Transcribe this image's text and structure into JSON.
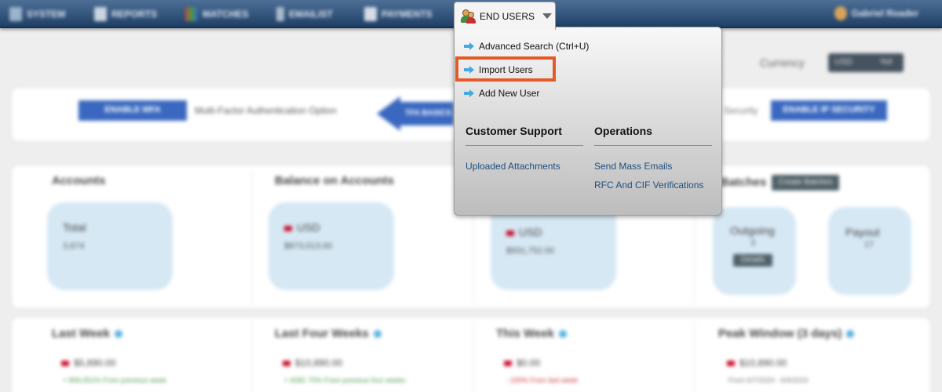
{
  "nav": {
    "items": [
      {
        "label": "SYSTEM",
        "icon": "system-icon"
      },
      {
        "label": "REPORTS",
        "icon": "reports-icon"
      },
      {
        "label": "MATCHES",
        "icon": "matches-icon"
      },
      {
        "label": "EMAILIST",
        "icon": "emailist-icon"
      },
      {
        "label": "PAYMENTS",
        "icon": "payments-icon"
      }
    ],
    "active": {
      "label": "END USERS",
      "icon": "users-icon"
    },
    "user_name": "Gabriel Reader"
  },
  "dropdown": {
    "items": [
      {
        "label": "Advanced Search (Ctrl+U)"
      },
      {
        "label": "Import Users"
      },
      {
        "label": "Add New User"
      }
    ],
    "sections": [
      {
        "heading": "Customer Support",
        "links": [
          "Uploaded Attachments"
        ]
      },
      {
        "heading": "Operations",
        "links": [
          "Send Mass Emails",
          "RFC And CIF Verifications"
        ]
      }
    ]
  },
  "header": {
    "currency_label": "Currency",
    "currency_options": [
      "USD",
      "%#"
    ]
  },
  "security": {
    "enable_mfa": "ENABLE MFA",
    "mfa_text": "Multi-Factor Authentication Option",
    "arrow_label": "TFA BASICS",
    "ip_text": "Security",
    "enable_ip": "ENABLE IP SECURITY"
  },
  "stats": {
    "accounts": {
      "title": "Accounts",
      "label": "Total",
      "value": "3,674"
    },
    "balance": {
      "title": "Balance on Accounts",
      "label": "USD",
      "value": "$873,013.00"
    },
    "third": {
      "label": "USD",
      "value": "$931,752.00"
    },
    "batches": {
      "title": "Batches",
      "badge": "Create Batches",
      "outgoing_label": "Outgoing",
      "outgoing_value": "3",
      "outgoing_pill": "Details",
      "payout_label": "Payout",
      "payout_value": "17"
    }
  },
  "weeks": [
    {
      "title": "Last Week",
      "amount": "$5,890.00",
      "sub": "+ 806,051% From previous week"
    },
    {
      "title": "Last Four Weeks",
      "amount": "$10,890.00",
      "sub": "+ 6081 70% From previous four weeks"
    },
    {
      "title": "This Week",
      "amount": "$0.00",
      "sub": "- 100% From last week"
    },
    {
      "title": "Peak Window (3 days)",
      "amount": "$10,890.00",
      "sub": "From 6/7/2024 - 6/9/2024"
    }
  ],
  "colors": {
    "nav_top": "#4d6f96",
    "nav_bottom": "#1f3f66",
    "highlight": "#e25a27",
    "link": "#1f4f7f",
    "arrow": "#45a9e0",
    "button_blue": "#3a68c0",
    "bubble": "#d6e8f4"
  }
}
